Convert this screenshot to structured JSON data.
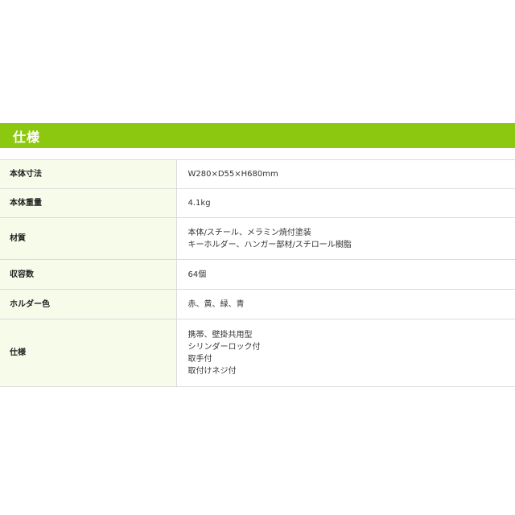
{
  "section": {
    "title": "仕様"
  },
  "specs": [
    {
      "label": "本体寸法",
      "lines": [
        "W280×D55×H680mm"
      ]
    },
    {
      "label": "本体重量",
      "lines": [
        "4.1kg"
      ]
    },
    {
      "label": "材質",
      "lines": [
        "本体/スチール、メラミン焼付塗装",
        "キーホルダー、ハンガー部材/スチロール樹脂"
      ]
    },
    {
      "label": "収容数",
      "lines": [
        "64個"
      ]
    },
    {
      "label": "ホルダー色",
      "lines": [
        "赤、黄、緑、青"
      ]
    },
    {
      "label": "仕様",
      "lines": [
        "携帯、壁掛共用型",
        "シリンダーロック付",
        "取手付",
        "取付けネジ付"
      ]
    }
  ],
  "colors": {
    "header_bg": "#8cc810",
    "label_bg": "#f6fbea",
    "border": "#dcdcdc"
  }
}
